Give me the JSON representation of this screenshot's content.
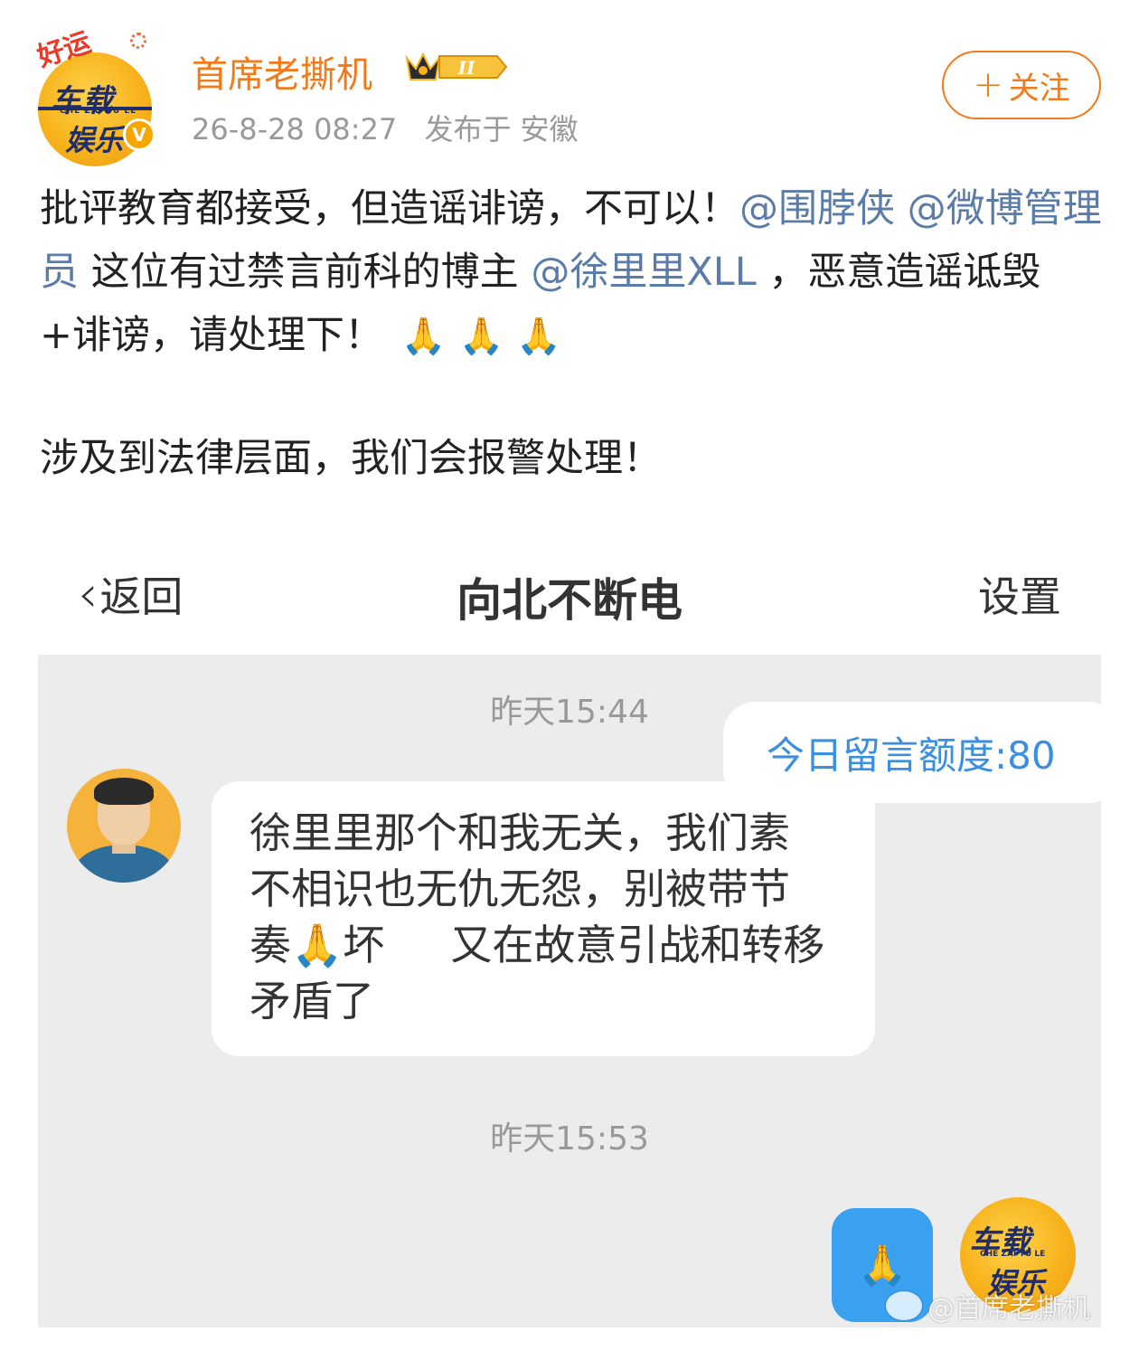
{
  "post": {
    "username": "首席老撕机",
    "level_badge": "II",
    "timestamp": "26-8-28 08:27",
    "location": "发布于 安徽",
    "follow_label": "关注",
    "follow_plus": "+",
    "avatar": {
      "lucky_text": "好运",
      "line1": "车载",
      "line2": "CHE ZAI YU LE",
      "line3": "娱乐",
      "verified_mark": "V"
    },
    "body": {
      "seg1": "批评教育都接受，但造谣诽谤，不可以！",
      "mention1": "@围脖侠",
      "mention2": "@微博管理员",
      "seg2": "这位有过禁言前科的博主",
      "mention3": "@徐里里XLL",
      "seg3": "，恶意造谣诋毁+诽谤，请处理下！",
      "emoji": [
        "🙏",
        "🙏",
        "🙏"
      ]
    },
    "paragraph2": "涉及到法律层面，我们会报警处理！"
  },
  "screenshot": {
    "nav": {
      "back_label": "返回",
      "title": "向北不断电",
      "settings_label": "设置"
    },
    "timestamp1": "昨天15:44",
    "quota_text": "今日留言额度:80",
    "peer_message_lines": [
      "徐里里那个和我无关，我们素",
      "不相识也无仇无怨，别被带节",
      "奏🙏坏     又在故意引战和转移",
      "矛盾了"
    ],
    "timestamp2": "昨天15:53",
    "reply_emoji": "🙏",
    "self_avatar": {
      "line1": "车载",
      "line2": "CHE ZAI YU LE",
      "line3": "娱乐"
    },
    "watermark": "@首席老撕机"
  },
  "colors": {
    "username": "#f27a1a",
    "mention": "#5b7ca8",
    "quota": "#3a8fe0",
    "chat_bg": "#ececec"
  }
}
